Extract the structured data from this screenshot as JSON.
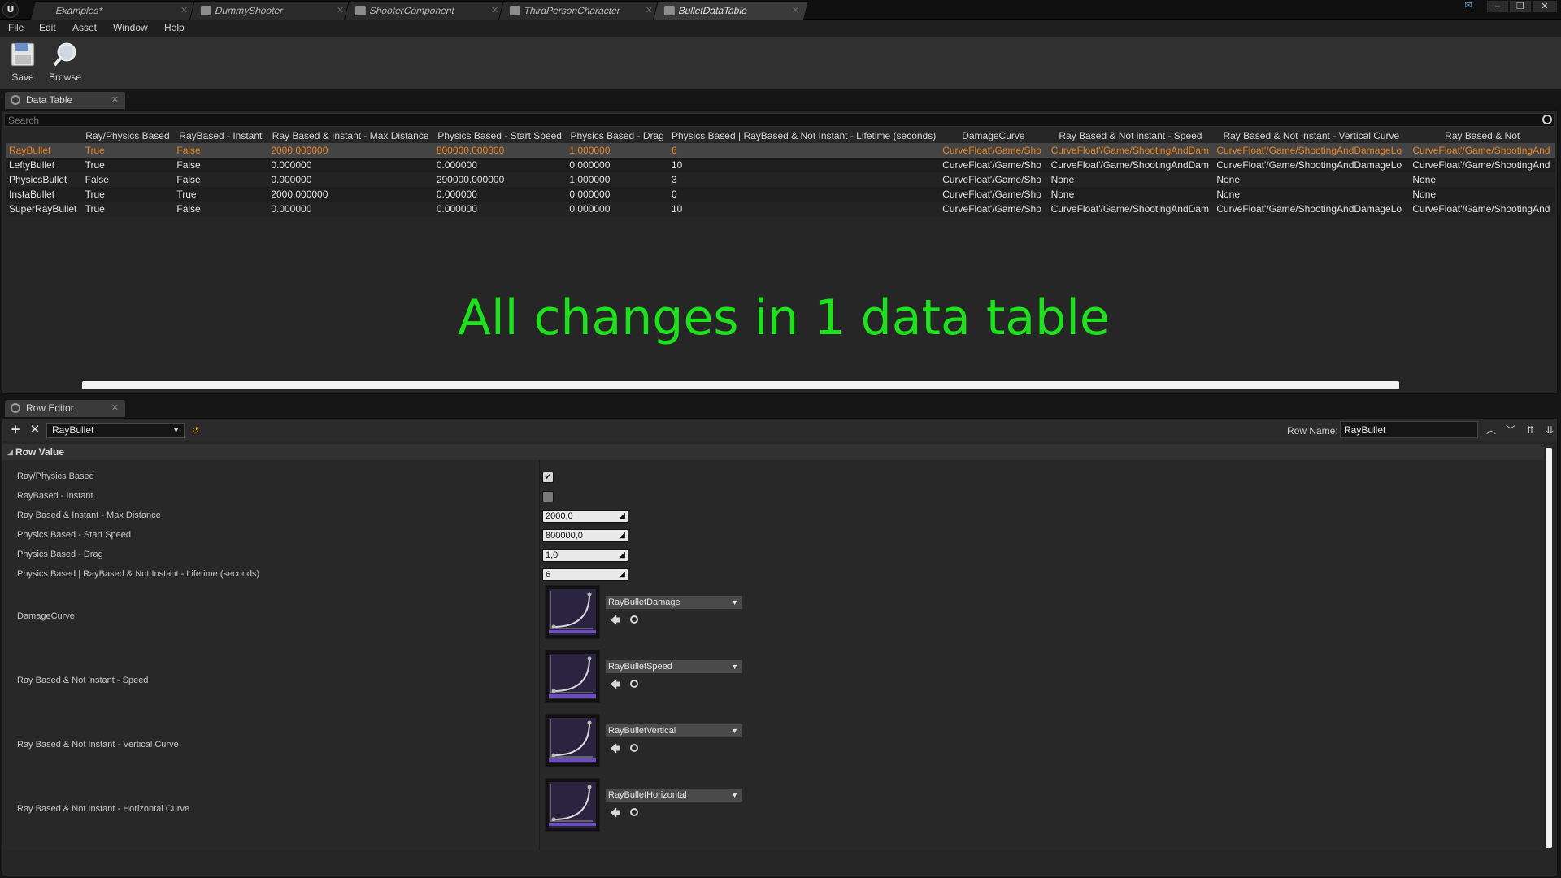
{
  "titlebar": {
    "tabs": [
      {
        "label": "Examples*"
      },
      {
        "label": "DummyShooter"
      },
      {
        "label": "ShooterComponent"
      },
      {
        "label": "ThirdPersonCharacter"
      },
      {
        "label": "BulletDataTable"
      }
    ],
    "active_tab": "BulletDataTable"
  },
  "menu": {
    "items": [
      "File",
      "Edit",
      "Asset",
      "Window",
      "Help"
    ]
  },
  "toolbar": {
    "save_label": "Save",
    "browse_label": "Browse"
  },
  "data_table": {
    "tab_label": "Data Table",
    "search_placeholder": "Search",
    "columns": [
      "",
      "Ray/Physics Based",
      "RayBased - Instant",
      "Ray Based & Instant - Max Distance",
      "Physics Based - Start Speed",
      "Physics Based - Drag",
      "Physics Based | RayBased & Not Instant - Lifetime (seconds)",
      "DamageCurve",
      "Ray Based & Not instant - Speed",
      "Ray Based & Not Instant - Vertical Curve",
      "Ray Based & Not"
    ],
    "rows": [
      {
        "name": "RayBullet",
        "cells": [
          "True",
          "False",
          "2000.000000",
          "800000.000000",
          "1.000000",
          "6",
          "CurveFloat'/Game/Sho",
          "CurveFloat'/Game/ShootingAndDam",
          "CurveFloat'/Game/ShootingAndDamageLo",
          "CurveFloat'/Game/ShootingAnd"
        ]
      },
      {
        "name": "LeftyBullet",
        "cells": [
          "True",
          "False",
          "0.000000",
          "0.000000",
          "0.000000",
          "10",
          "CurveFloat'/Game/Sho",
          "CurveFloat'/Game/ShootingAndDam",
          "CurveFloat'/Game/ShootingAndDamageLo",
          "CurveFloat'/Game/ShootingAnd"
        ]
      },
      {
        "name": "PhysicsBullet",
        "cells": [
          "False",
          "False",
          "0.000000",
          "290000.000000",
          "1.000000",
          "3",
          "CurveFloat'/Game/Sho",
          "None",
          "None",
          "None"
        ]
      },
      {
        "name": "InstaBullet",
        "cells": [
          "True",
          "True",
          "2000.000000",
          "0.000000",
          "0.000000",
          "0",
          "CurveFloat'/Game/Sho",
          "None",
          "None",
          "None"
        ]
      },
      {
        "name": "SuperRayBullet",
        "cells": [
          "True",
          "False",
          "0.000000",
          "0.000000",
          "0.000000",
          "10",
          "CurveFloat'/Game/Sho",
          "CurveFloat'/Game/ShootingAndDam",
          "CurveFloat'/Game/ShootingAndDamageLo",
          "CurveFloat'/Game/ShootingAnd"
        ]
      }
    ],
    "selected_row": "RayBullet",
    "overlay_text": "All changes in 1 data table"
  },
  "row_editor": {
    "tab_label": "Row Editor",
    "selected_row": "RayBullet",
    "row_name_label": "Row Name:",
    "row_name_value": "RayBullet",
    "section_title": "Row Value",
    "properties": {
      "ray_physics_based": {
        "label": "Ray/Physics Based",
        "checked": true
      },
      "raybased_instant": {
        "label": "RayBased - Instant",
        "checked": false
      },
      "max_distance": {
        "label": "Ray Based & Instant - Max Distance",
        "value": "2000,0"
      },
      "start_speed": {
        "label": "Physics Based - Start Speed",
        "value": "800000,0"
      },
      "drag": {
        "label": "Physics Based - Drag",
        "value": "1,0"
      },
      "lifetime": {
        "label": "Physics Based | RayBased & Not Instant - Lifetime (seconds)",
        "value": "6"
      },
      "damage_curve": {
        "label": "DamageCurve",
        "asset": "RayBulletDamage"
      },
      "speed_curve": {
        "label": "Ray Based & Not instant - Speed",
        "asset": "RayBulletSpeed"
      },
      "vertical_curve": {
        "label": "Ray Based & Not Instant - Vertical Curve",
        "asset": "RayBulletVertical"
      },
      "horizontal_curve": {
        "label": "Ray Based & Not Instant - Horizontal Curve",
        "asset": "RayBulletHorizontal"
      }
    }
  },
  "colors": {
    "selected_row_text": "#e8821f",
    "overlay_text": "#1ee11e",
    "curve_thumb_accent": "#6a4bc0"
  }
}
